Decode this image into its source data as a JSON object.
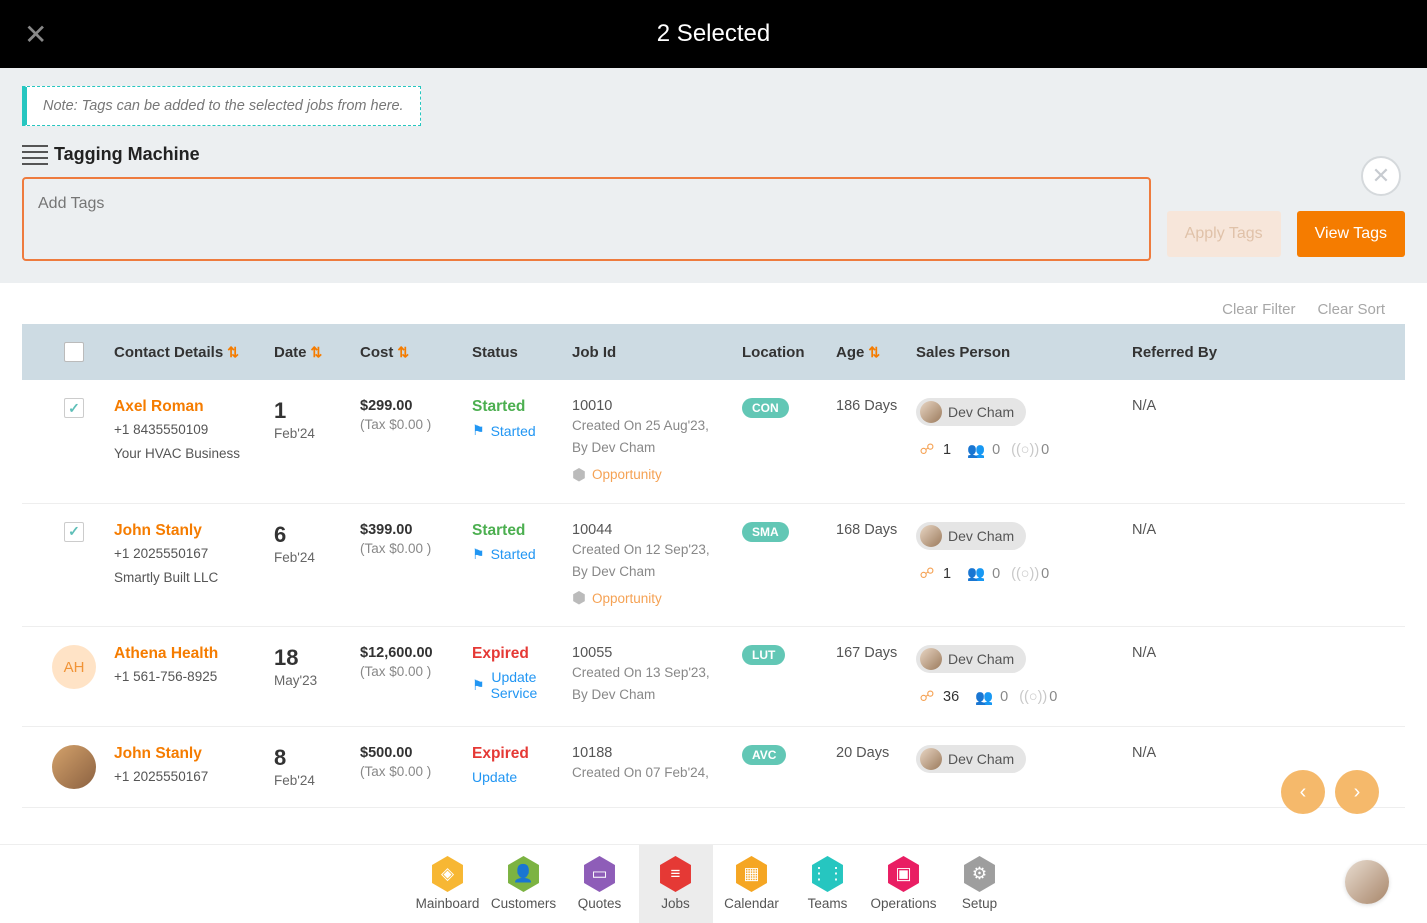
{
  "topbar": {
    "title": "2 Selected"
  },
  "panel": {
    "note": "Note: Tags can be added to the selected jobs from here.",
    "heading": "Tagging Machine",
    "placeholder": "Add Tags",
    "apply_label": "Apply Tags",
    "view_label": "View Tags"
  },
  "filters": {
    "clear_filter": "Clear Filter",
    "clear_sort": "Clear Sort"
  },
  "headers": {
    "contact": "Contact Details",
    "date": "Date",
    "cost": "Cost",
    "status": "Status",
    "jobid": "Job Id",
    "location": "Location",
    "age": "Age",
    "sales": "Sales Person",
    "ref": "Referred By"
  },
  "rows": [
    {
      "checked": true,
      "avatar_type": "none",
      "name": "Axel Roman",
      "phone": "+1 8435550109",
      "company": "Your HVAC Business",
      "date_big": "1",
      "date_sub": "Feb'24",
      "cost": "$299.00",
      "tax": "(Tax $0.00 )",
      "status": "Started",
      "status_class": "started",
      "status_link": "Started",
      "show_flag": true,
      "jobid": "10010",
      "created": "Created On 25 Aug'23,",
      "by": "By Dev Cham",
      "opportunity": "Opportunity",
      "loc": "CON",
      "loc_color": "#62c7b5",
      "age": "186 Days",
      "sales": "Dev Cham",
      "m1": "1",
      "m2": "0",
      "m3": "0",
      "ref": "N/A"
    },
    {
      "checked": true,
      "avatar_type": "none",
      "name": "John Stanly",
      "phone": "+1 2025550167",
      "company": "Smartly Built LLC",
      "date_big": "6",
      "date_sub": "Feb'24",
      "cost": "$399.00",
      "tax": "(Tax $0.00 )",
      "status": "Started",
      "status_class": "started",
      "status_link": "Started",
      "show_flag": true,
      "jobid": "10044",
      "created": "Created On 12 Sep'23,",
      "by": "By Dev Cham",
      "opportunity": "Opportunity",
      "loc": "SMA",
      "loc_color": "#62c7b5",
      "age": "168 Days",
      "sales": "Dev Cham",
      "m1": "1",
      "m2": "0",
      "m3": "0",
      "ref": "N/A"
    },
    {
      "checked": false,
      "avatar_type": "initials",
      "avatar_text": "AH",
      "name": "Athena Health",
      "phone": "+1 561-756-8925",
      "company": "",
      "date_big": "18",
      "date_sub": "May'23",
      "cost": "$12,600.00",
      "tax": "(Tax $0.00 )",
      "status": "Expired",
      "status_class": "expired",
      "status_link": "Update Service",
      "show_flag": true,
      "jobid": "10055",
      "created": "Created On 13 Sep'23,",
      "by": "By Dev Cham",
      "opportunity": "",
      "loc": "LUT",
      "loc_color": "#62c7b5",
      "age": "167 Days",
      "sales": "Dev Cham",
      "m1": "36",
      "m2": "0",
      "m3": "0",
      "ref": "N/A"
    },
    {
      "checked": false,
      "avatar_type": "photo",
      "name": "John Stanly",
      "phone": "+1 2025550167",
      "company": "",
      "date_big": "8",
      "date_sub": "Feb'24",
      "cost": "$500.00",
      "tax": "(Tax $0.00 )",
      "status": "Expired",
      "status_class": "expired",
      "status_link": "Update",
      "show_flag": false,
      "jobid": "10188",
      "created": "Created On 07 Feb'24,",
      "by": "",
      "opportunity": "",
      "loc": "AVC",
      "loc_color": "#62c7b5",
      "age": "20 Days",
      "sales": "Dev Cham",
      "m1": "",
      "m2": "",
      "m3": "",
      "ref": "N/A"
    }
  ],
  "nav": {
    "items": [
      {
        "label": "Mainboard",
        "color": "#f7b733",
        "glyph": "◈"
      },
      {
        "label": "Customers",
        "color": "#7cb342",
        "glyph": "👤"
      },
      {
        "label": "Quotes",
        "color": "#8e5db8",
        "glyph": "▭"
      },
      {
        "label": "Jobs",
        "color": "#e53935",
        "glyph": "≡"
      },
      {
        "label": "Calendar",
        "color": "#f5a623",
        "glyph": "▦"
      },
      {
        "label": "Teams",
        "color": "#26c6c0",
        "glyph": "⋮⋮"
      },
      {
        "label": "Operations",
        "color": "#e91e63",
        "glyph": "▣"
      },
      {
        "label": "Setup",
        "color": "#9e9e9e",
        "glyph": "⚙"
      }
    ],
    "active_index": 3
  }
}
